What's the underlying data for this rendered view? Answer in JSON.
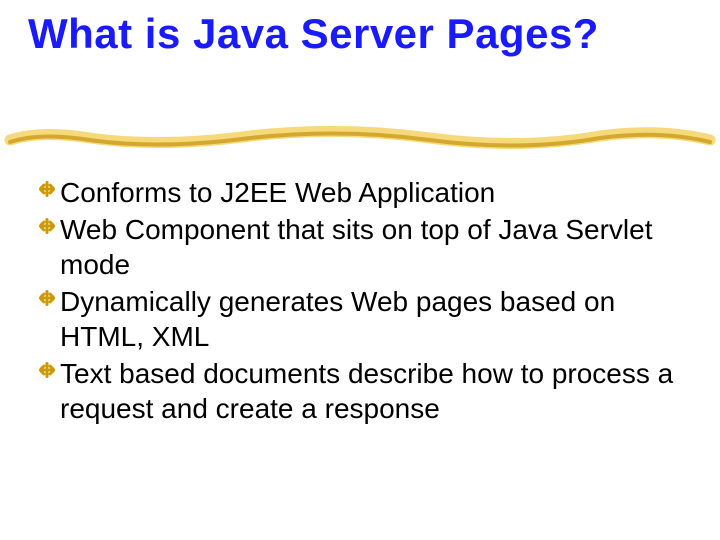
{
  "title": "What is Java Server Pages?",
  "bullets": [
    "Conforms to J2EE Web Application",
    "Web Component that sits on top of Java Servlet mode",
    "Dynamically generates Web pages based on HTML, XML",
    "Text based documents describe how to process a request and create a response"
  ],
  "colors": {
    "title": "#1a1aff",
    "bullet_icon": "#cc9900",
    "underline_light": "#f5d97a",
    "underline_dark": "#d4a82f"
  }
}
